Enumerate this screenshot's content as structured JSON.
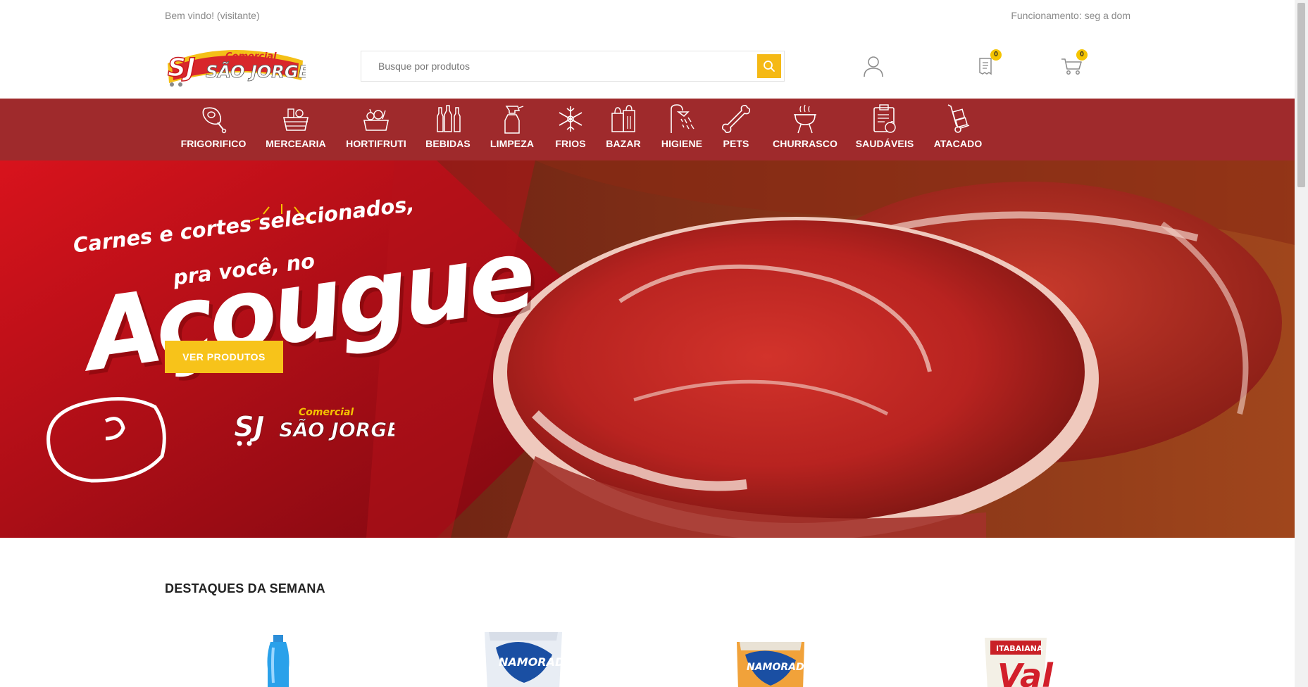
{
  "topbar": {
    "welcome": "Bem vindo! (visitante)",
    "hours": "Funcionamento: seg a dom"
  },
  "header": {
    "logo_text_top": "Comercial",
    "logo_text_main": "SÃO JORGE",
    "logo_mark": "SJ",
    "search_placeholder": "Busque por produtos",
    "account_icon": "user-icon",
    "list_count": "0",
    "cart_count": "0"
  },
  "categories": [
    {
      "label": "FRIGORIFICO",
      "icon": "meat-icon"
    },
    {
      "label": "MERCEARIA",
      "icon": "basket-icon"
    },
    {
      "label": "HORTIFRUTI",
      "icon": "vegetables-icon"
    },
    {
      "label": "BEBIDAS",
      "icon": "bottles-icon"
    },
    {
      "label": "LIMPEZA",
      "icon": "spray-bottle-icon"
    },
    {
      "label": "FRIOS",
      "icon": "snowflake-icon"
    },
    {
      "label": "BAZAR",
      "icon": "shopping-bags-icon"
    },
    {
      "label": "HIGIENE",
      "icon": "shower-icon"
    },
    {
      "label": "PETS",
      "icon": "bone-icon"
    },
    {
      "label": "CHURRASCO",
      "icon": "grill-icon"
    },
    {
      "label": "SAUDÁVEIS",
      "icon": "healthy-list-icon"
    },
    {
      "label": "ATACADO",
      "icon": "hand-truck-icon"
    }
  ],
  "hero": {
    "line1": "Carnes e cortes selecionados,",
    "line2": "pra você, no",
    "line3": "Açougue",
    "cta": "VER PRODUTOS",
    "brand_top": "Comercial",
    "brand_main": "SÃO JORGE",
    "brand_mark": "SJ"
  },
  "section": {
    "title": "DESTAQUES DA SEMANA"
  },
  "products": [
    {
      "image": "blue-bottle-product"
    },
    {
      "image": "namorado-rice-blue-package",
      "brand": "NAMORADO"
    },
    {
      "image": "namorado-rice-orange-package",
      "brand": "NAMORADO"
    },
    {
      "image": "val-flour-package",
      "brand": "Val",
      "sub": "ITABAIANA"
    }
  ],
  "colors": {
    "nav_bg": "#9f2a2c",
    "accent": "#f5b915",
    "badge": "#f5c400"
  }
}
